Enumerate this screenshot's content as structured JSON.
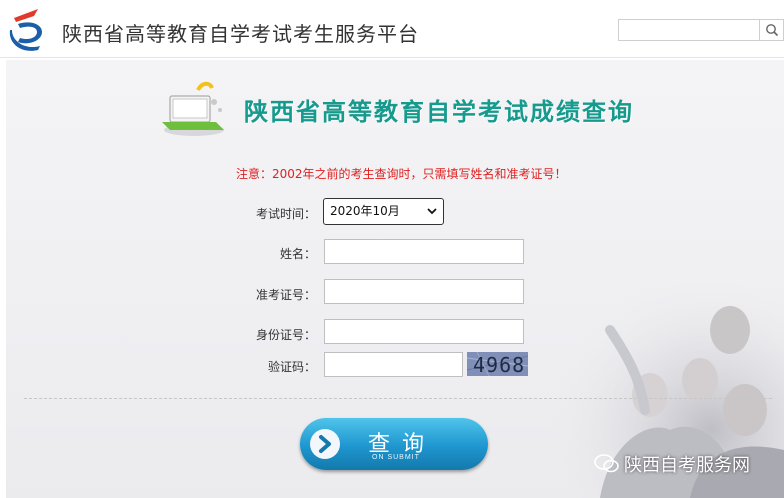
{
  "header": {
    "site_title": "陕西省高等教育自学考试考生服务平台",
    "search_placeholder": ""
  },
  "banner": {
    "title": "陕西省高等教育自学考试成绩查询"
  },
  "notice": "注意：2002年之前的考生查询时，只需填写姓名和准考证号！",
  "form": {
    "exam_time_label": "考试时间：",
    "exam_time_value": "2020年10月",
    "name_label": "姓名：",
    "admission_label": "准考证号：",
    "id_label": "身份证号：",
    "captcha_label": "验证码：",
    "captcha_text": "4968"
  },
  "submit": {
    "label": "查询",
    "sub_label": "ON SUBMIT"
  },
  "watermark": "陕西自考服务网",
  "colors": {
    "title_teal": "#169a8d",
    "notice_red": "#e02020",
    "button_blue": "#1e96cf"
  }
}
